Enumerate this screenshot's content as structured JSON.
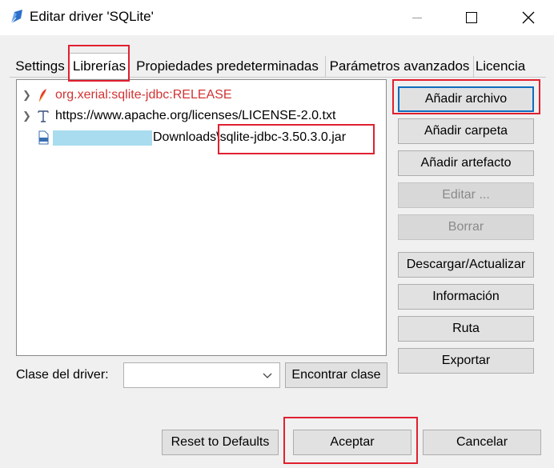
{
  "window": {
    "title": "Editar driver 'SQLite'",
    "icon": "pen-nib-icon"
  },
  "tabs": [
    {
      "label": "Settings",
      "active": false
    },
    {
      "label": "Librerías",
      "active": true
    },
    {
      "label": "Propiedades predeterminadas",
      "active": false
    },
    {
      "label": "Parámetros avanzados",
      "active": false
    },
    {
      "label": "Licencia",
      "active": false
    }
  ],
  "libraries": {
    "items": [
      {
        "label": "org.xerial:sqlite-jdbc:RELEASE",
        "icon": "maven-feather-icon",
        "expandable": true,
        "color": "#d23333"
      },
      {
        "label": "https://www.apache.org/licenses/LICENSE-2.0.txt",
        "icon": "text-file-icon",
        "expandable": true
      },
      {
        "label_folder": "Downloads",
        "label_file": "\\sqlite-jdbc-3.50.3.0.jar",
        "icon": "jar-file-icon",
        "expandable": false,
        "redacted": true
      }
    ]
  },
  "side_buttons": {
    "add_file": "Añadir archivo",
    "add_folder": "Añadir carpeta",
    "add_artifact": "Añadir artefacto",
    "edit": "Editar ...",
    "delete": "Borrar",
    "download_update": "Descargar/Actualizar",
    "info": "Información",
    "path": "Ruta",
    "export": "Exportar"
  },
  "driver_class": {
    "label": "Clase del driver:",
    "value": "",
    "find_label": "Encontrar clase"
  },
  "footer": {
    "reset": "Reset to Defaults",
    "accept": "Aceptar",
    "cancel": "Cancelar"
  },
  "colors": {
    "highlight": "#e02030",
    "focus": "#0f6cbd",
    "redaction": "#a8dcee"
  }
}
